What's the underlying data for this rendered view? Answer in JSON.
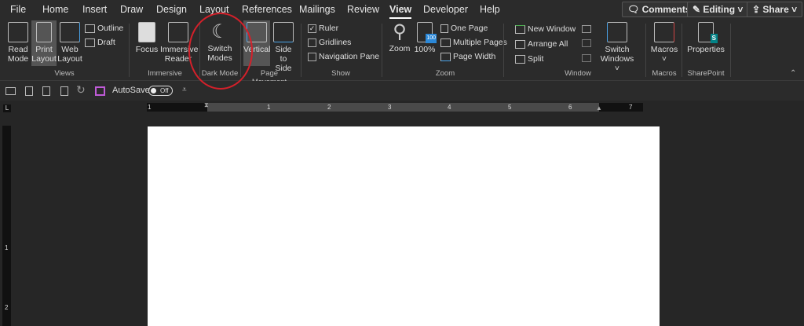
{
  "tabs": [
    "File",
    "Home",
    "Insert",
    "Draw",
    "Design",
    "Layout",
    "References",
    "Mailings",
    "Review",
    "View",
    "Developer",
    "Help"
  ],
  "active_tab": "View",
  "top_buttons": {
    "comments": "Comments",
    "editing": "Editing",
    "share": "Share"
  },
  "ribbon": {
    "views": {
      "label": "Views",
      "read_mode": "Read Mode",
      "print_layout": "Print Layout",
      "web_layout": "Web Layout",
      "outline": "Outline",
      "draft": "Draft"
    },
    "immersive": {
      "label": "Immersive",
      "focus": "Focus",
      "reader": "Immersive Reader"
    },
    "dark_mode": {
      "label": "Dark Mode",
      "switch": "Switch Modes"
    },
    "page_movement": {
      "label": "Page Movement",
      "vertical": "Vertical",
      "side": "Side to Side"
    },
    "show": {
      "label": "Show",
      "ruler": "Ruler",
      "gridlines": "Gridlines",
      "nav": "Navigation Pane",
      "ruler_checked": true
    },
    "zoom": {
      "label": "Zoom",
      "zoom": "Zoom",
      "hundred": "100%",
      "one_page": "One Page",
      "multiple": "Multiple Pages",
      "width": "Page Width",
      "badge": "100"
    },
    "window": {
      "label": "Window",
      "new": "New Window",
      "arrange": "Arrange All",
      "split": "Split",
      "switch": "Switch Windows"
    },
    "macros": {
      "label": "Macros",
      "macros": "Macros"
    },
    "sharepoint": {
      "label": "SharePoint",
      "properties": "Properties",
      "badge": "S"
    }
  },
  "qat": {
    "autosave": "AutoSave",
    "toggle": "Off"
  },
  "ruler": {
    "numbers": [
      "1",
      "1",
      "2",
      "3",
      "4",
      "5",
      "6",
      "7"
    ]
  },
  "vruler": {
    "numbers": [
      "1",
      "2"
    ]
  },
  "colors": {
    "accent_circle": "#d4202a",
    "save_icon": "#c05bd8"
  }
}
